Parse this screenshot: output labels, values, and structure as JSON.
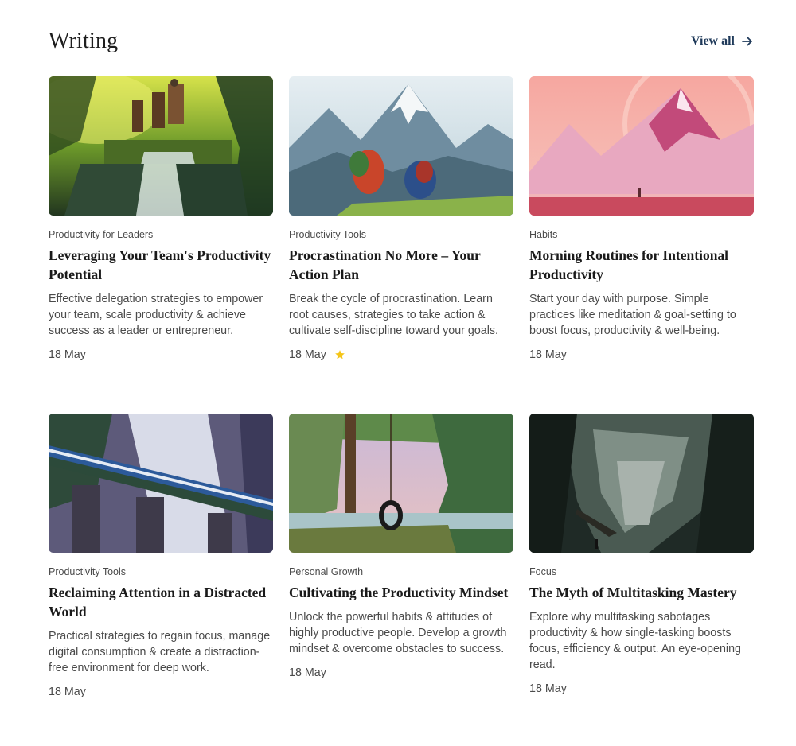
{
  "section": {
    "title": "Writing",
    "view_all_label": "View all"
  },
  "colors": {
    "link": "#1f3a5a",
    "star": "#f5c518"
  },
  "posts": [
    {
      "category": "Productivity for Leaders",
      "title": "Leveraging Your Team's Productivity Potential",
      "excerpt": "Effective delegation strategies to empower your team, scale productivity & achieve success as a leader or entrepreneur.",
      "date": "18 May",
      "starred": false,
      "image": "riders-waterfall-forest"
    },
    {
      "category": "Productivity Tools",
      "title": "Procrastination No More – Your Action Plan",
      "excerpt": "Break the cycle of procrastination. Learn root causes, strategies to take action & cultivate self-discipline toward your goals.",
      "date": "18 May",
      "starred": true,
      "image": "warriors-mountain-peaks"
    },
    {
      "category": "Habits",
      "title": "Morning Routines for Intentional Productivity",
      "excerpt": "Start your day with purpose. Simple practices like meditation & goal-setting to boost focus, productivity & well-being.",
      "date": "18 May",
      "starred": false,
      "image": "pink-mountain-lake"
    },
    {
      "category": "Productivity Tools",
      "title": "Reclaiming Attention in a Distracted World",
      "excerpt": "Practical strategies to regain focus, manage digital consumption & create a distraction-free environment for deep work.",
      "date": "18 May",
      "starred": false,
      "image": "train-viaduct-waterfall"
    },
    {
      "category": "Personal Growth",
      "title": "Cultivating the Productivity Mindset",
      "excerpt": "Unlock the powerful habits & attitudes of highly productive people. Develop a growth mindset & overcome obstacles to success.",
      "date": "18 May",
      "starred": false,
      "image": "tire-swing-lake"
    },
    {
      "category": "Focus",
      "title": "The Myth of Multitasking Mastery",
      "excerpt": "Explore why multitasking sabotages productivity & how single-tasking boosts focus, efficiency & output. An eye-opening read.",
      "date": "18 May",
      "starred": false,
      "image": "dark-cave-ruins"
    }
  ]
}
